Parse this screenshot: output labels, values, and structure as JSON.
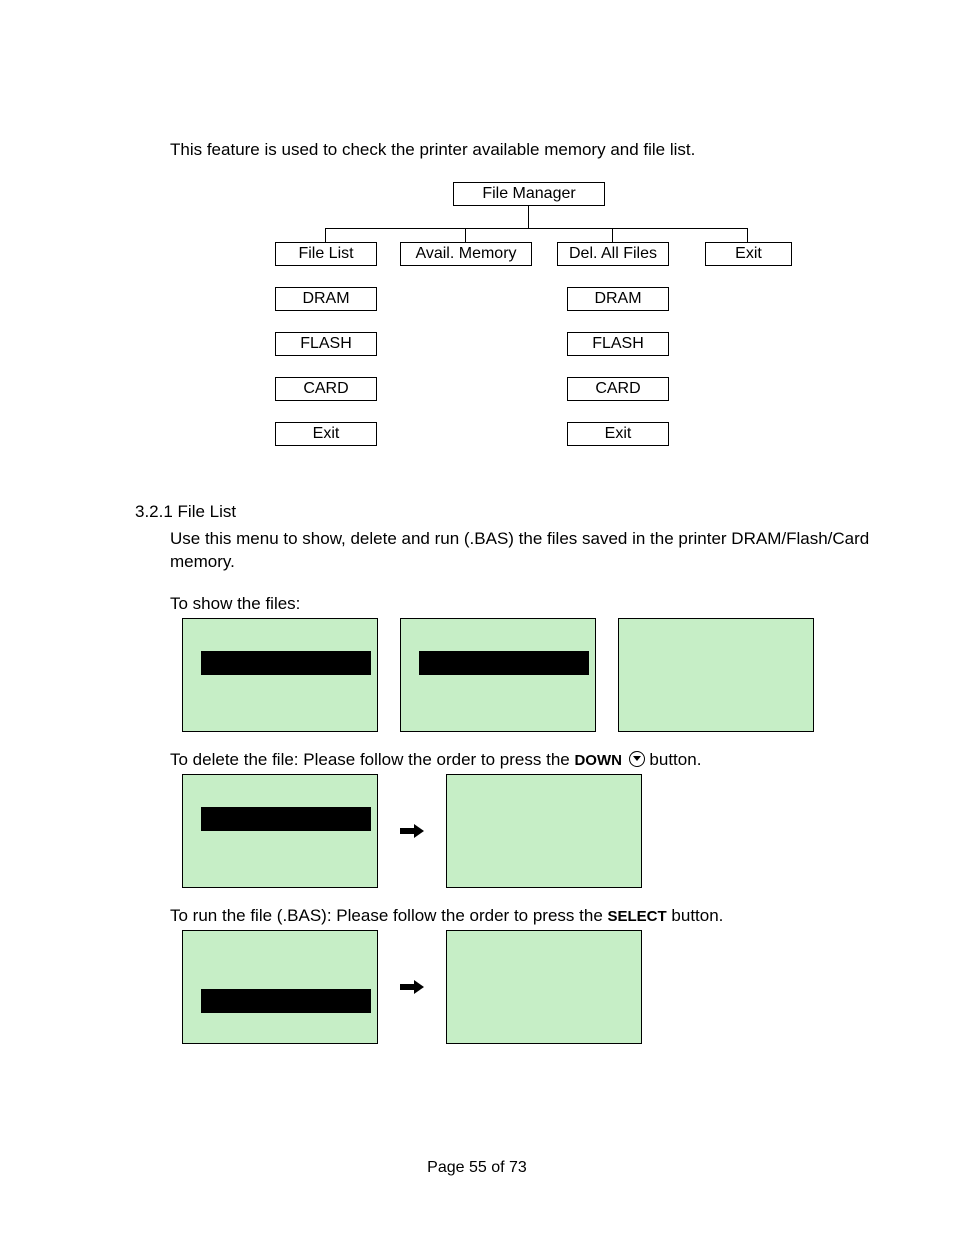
{
  "intro": "This feature is used to check the printer available memory and file list.",
  "tree": {
    "root": "File Manager",
    "headers": [
      "File List",
      "Avail. Memory",
      "Del. All Files",
      "Exit"
    ],
    "col1": [
      "DRAM",
      "FLASH",
      "CARD",
      "Exit"
    ],
    "col3": [
      "DRAM",
      "FLASH",
      "CARD",
      "Exit"
    ]
  },
  "section": {
    "number_title": "3.2.1 File List",
    "desc": "Use this menu to show, delete and run (.BAS) the files saved in the printer DRAM/Flash/Card memory.",
    "show_label": "To show the files:",
    "delete_prefix": "To delete the file: Please follow the order to press the ",
    "delete_btn": "DOWN",
    "delete_suffix": " button.",
    "run_prefix": "To run the file (.BAS): Please follow the order to press the ",
    "run_btn": "SELECT",
    "run_suffix": " button."
  },
  "footer": "Page 55 of 73"
}
